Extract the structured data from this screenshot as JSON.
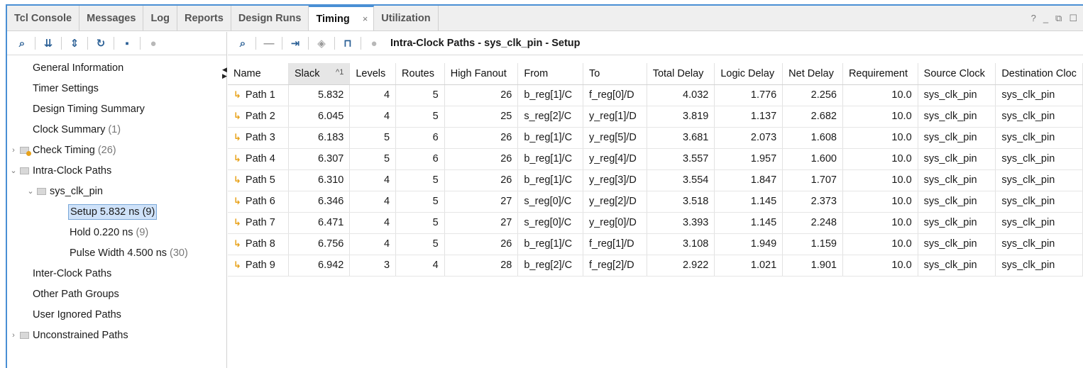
{
  "tabs": [
    {
      "label": "Tcl Console",
      "active": false
    },
    {
      "label": "Messages",
      "active": false
    },
    {
      "label": "Log",
      "active": false
    },
    {
      "label": "Reports",
      "active": false
    },
    {
      "label": "Design Runs",
      "active": false
    },
    {
      "label": "Timing",
      "active": true,
      "close": "×"
    },
    {
      "label": "Utilization",
      "active": false
    }
  ],
  "window_controls": {
    "help": "?",
    "minimize": "_",
    "restore": "⧉",
    "maximize": "☐"
  },
  "left_toolbar": {
    "icons": [
      "search-icon",
      "collapse-all-icon",
      "expand-all-icon",
      "refresh-icon",
      "save-icon",
      "record-icon"
    ],
    "glyphs": {
      "search": "⌕",
      "collapse": "⇊",
      "expand": "⇕",
      "refresh": "↻",
      "save": "▪",
      "record": "●"
    }
  },
  "tree": {
    "general_information": "General Information",
    "timer_settings": "Timer Settings",
    "design_timing_summary": "Design Timing Summary",
    "clock_summary": {
      "label": "Clock Summary",
      "count": "(1)"
    },
    "check_timing": {
      "label": "Check Timing",
      "count": "(26)"
    },
    "intra_clock_paths": "Intra-Clock Paths",
    "sys_clk_pin": "sys_clk_pin",
    "setup": "Setup 5.832 ns (9)",
    "hold": {
      "label": "Hold 0.220 ns",
      "count": "(9)"
    },
    "pulse_width": {
      "label": "Pulse Width 4.500 ns",
      "count": "(30)"
    },
    "inter_clock_paths": "Inter-Clock Paths",
    "other_path_groups": "Other Path Groups",
    "user_ignored_paths": "User Ignored Paths",
    "unconstrained_paths": "Unconstrained Paths",
    "chevrons": {
      "collapsed": "›",
      "expanded": "⌄"
    }
  },
  "right_toolbar": {
    "title": "Intra-Clock Paths - sys_clk_pin - Setup",
    "glyphs": {
      "search": "⌕",
      "minus": "—",
      "goto": "⇥",
      "diamond": "◈",
      "pulse": "⊓",
      "record": "●"
    }
  },
  "table": {
    "columns": [
      "Name",
      "Slack",
      "Levels",
      "Routes",
      "High Fanout",
      "From",
      "To",
      "Total Delay",
      "Logic Delay",
      "Net Delay",
      "Requirement",
      "Source Clock",
      "Destination Cloc"
    ],
    "sort_indicator": "^1",
    "rows": [
      [
        "Path 1",
        "5.832",
        "4",
        "5",
        "26",
        "b_reg[1]/C",
        "f_reg[0]/D",
        "4.032",
        "1.776",
        "2.256",
        "10.0",
        "sys_clk_pin",
        "sys_clk_pin"
      ],
      [
        "Path 2",
        "6.045",
        "4",
        "5",
        "25",
        "s_reg[2]/C",
        "y_reg[1]/D",
        "3.819",
        "1.137",
        "2.682",
        "10.0",
        "sys_clk_pin",
        "sys_clk_pin"
      ],
      [
        "Path 3",
        "6.183",
        "5",
        "6",
        "26",
        "b_reg[1]/C",
        "y_reg[5]/D",
        "3.681",
        "2.073",
        "1.608",
        "10.0",
        "sys_clk_pin",
        "sys_clk_pin"
      ],
      [
        "Path 4",
        "6.307",
        "5",
        "6",
        "26",
        "b_reg[1]/C",
        "y_reg[4]/D",
        "3.557",
        "1.957",
        "1.600",
        "10.0",
        "sys_clk_pin",
        "sys_clk_pin"
      ],
      [
        "Path 5",
        "6.310",
        "4",
        "5",
        "26",
        "b_reg[1]/C",
        "y_reg[3]/D",
        "3.554",
        "1.847",
        "1.707",
        "10.0",
        "sys_clk_pin",
        "sys_clk_pin"
      ],
      [
        "Path 6",
        "6.346",
        "4",
        "5",
        "27",
        "s_reg[0]/C",
        "y_reg[2]/D",
        "3.518",
        "1.145",
        "2.373",
        "10.0",
        "sys_clk_pin",
        "sys_clk_pin"
      ],
      [
        "Path 7",
        "6.471",
        "4",
        "5",
        "27",
        "s_reg[0]/C",
        "y_reg[0]/D",
        "3.393",
        "1.145",
        "2.248",
        "10.0",
        "sys_clk_pin",
        "sys_clk_pin"
      ],
      [
        "Path 8",
        "6.756",
        "4",
        "5",
        "26",
        "b_reg[1]/C",
        "f_reg[1]/D",
        "3.108",
        "1.949",
        "1.159",
        "10.0",
        "sys_clk_pin",
        "sys_clk_pin"
      ],
      [
        "Path 9",
        "6.942",
        "3",
        "4",
        "28",
        "b_reg[2]/C",
        "f_reg[2]/D",
        "2.922",
        "1.021",
        "1.901",
        "10.0",
        "sys_clk_pin",
        "sys_clk_pin"
      ]
    ],
    "path_glyph": "↳"
  },
  "colors": {
    "accent": "#4a8fd4",
    "selection": "#cfe2f9",
    "path_icon": "#e8a21a",
    "toolbar_icon": "#2a5f95"
  }
}
